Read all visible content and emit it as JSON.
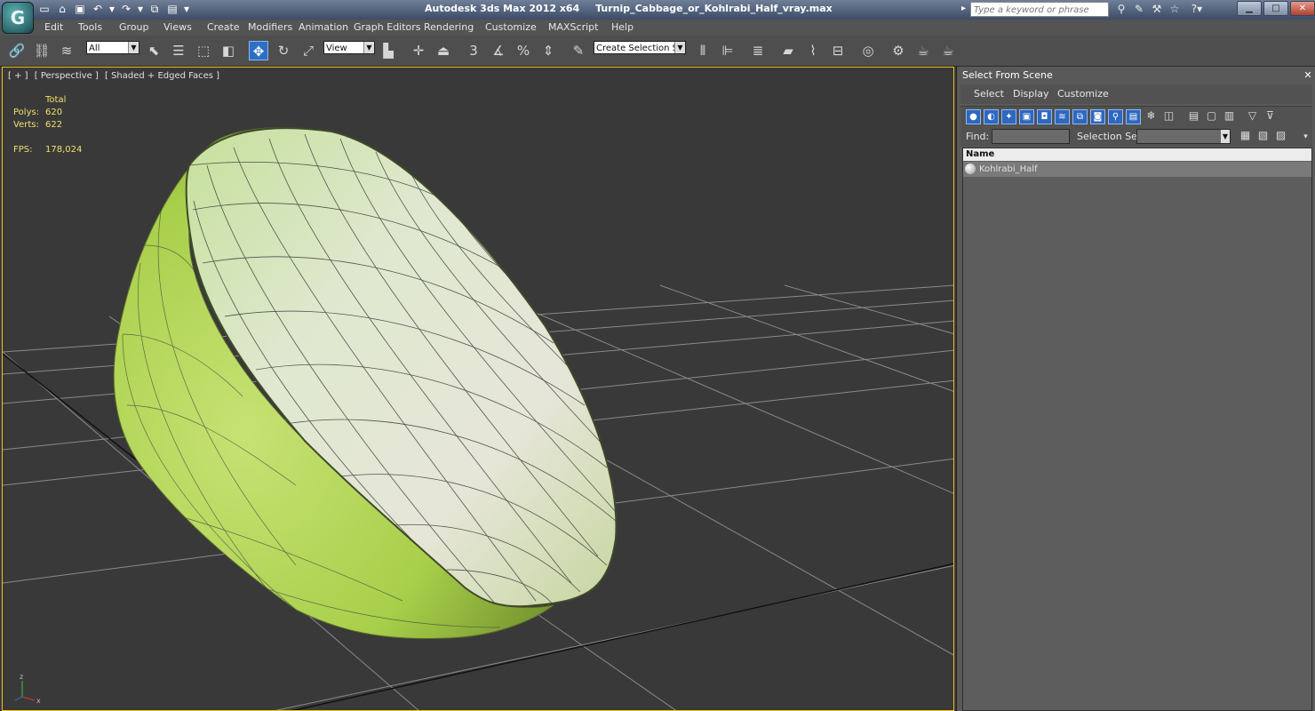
{
  "app_title": "Autodesk 3ds Max  2012 x64",
  "file_name": "Turnip_Cabbage_or_Kohlrabi_Half_vray.max",
  "search": {
    "placeholder": "Type a keyword or phrase"
  },
  "menu": [
    "Edit",
    "Tools",
    "Group",
    "Views",
    "Create",
    "Modifiers",
    "Animation",
    "Graph Editors",
    "Rendering",
    "Customize",
    "MAXScript",
    "Help"
  ],
  "toolbar": {
    "filter_value": "All",
    "ref_coord_value": "View",
    "selection_set_value": "Create Selection Se"
  },
  "viewport": {
    "labels": [
      "[ + ]",
      "[ Perspective ]",
      "[ Shaded + Edged Faces ]"
    ],
    "stats": {
      "header": "Total",
      "polys_label": "Polys:",
      "polys_value": "620",
      "verts_label": "Verts:",
      "verts_value": "622",
      "fps_label": "FPS:",
      "fps_value": "178,024"
    }
  },
  "scene_panel": {
    "title": "Select From Scene",
    "menu": [
      "Select",
      "Display",
      "Customize"
    ],
    "find_label": "Find:",
    "selection_set_label": "Selection Set:",
    "column_header": "Name",
    "objects": [
      "Kohlrabi_Half"
    ]
  },
  "colors": {
    "stats_text": "#f0e16a",
    "active_border": "#f0c020",
    "active_tool": "#2c6fc4"
  }
}
